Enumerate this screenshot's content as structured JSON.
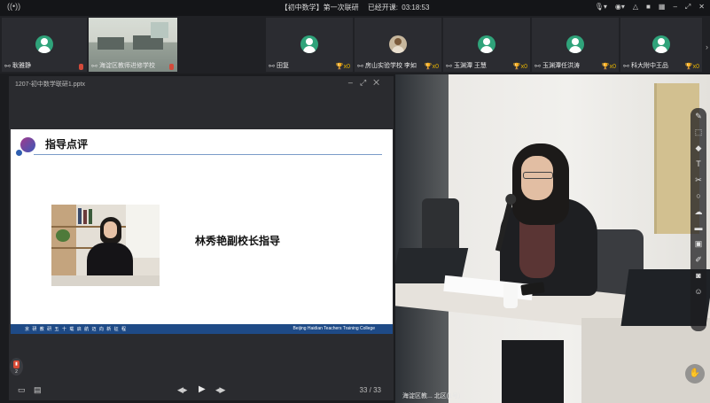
{
  "window": {
    "title": "【初中数学】第一次联研",
    "status": "已经开课:",
    "timer": "03:18:53"
  },
  "participants": [
    {
      "name": "耿雅静",
      "count": "",
      "has_video": false
    },
    {
      "name": "海淀区教师进修学校",
      "count": "",
      "has_video": true
    },
    {
      "name": "田复",
      "count": "x0",
      "has_video": false
    },
    {
      "name": "房山实验学校 李如",
      "count": "x0",
      "has_video": false,
      "photo": true
    },
    {
      "name": "玉渊潭 王慧",
      "count": "x0",
      "has_video": false
    },
    {
      "name": "玉渊潭任洪涛",
      "count": "x0",
      "has_video": false
    },
    {
      "name": "科大附中王品",
      "count": "x0",
      "has_video": false
    }
  ],
  "ppt": {
    "filename": "1207-初中数学联研1.pptx",
    "slide_title": "指导点评",
    "speaker_line": "林秀艳副校长指导",
    "footer_left": "京 研 教 研 五 十 载   启 航 迈 向 新 征 程",
    "footer_right": "Beijing Haidian Teachers Training College",
    "page_current": "33",
    "page_total": "33",
    "annotation_count": "2"
  },
  "video": {
    "caption": "海淀区教... 北区(1号)"
  },
  "icons": {
    "toolbar": [
      "pen-icon",
      "select-icon",
      "highlighter-icon",
      "text-icon",
      "scissors-icon",
      "circle-icon",
      "cloud-icon",
      "layers-icon",
      "save-icon",
      "edit-icon",
      "camera-icon",
      "people-icon"
    ]
  }
}
